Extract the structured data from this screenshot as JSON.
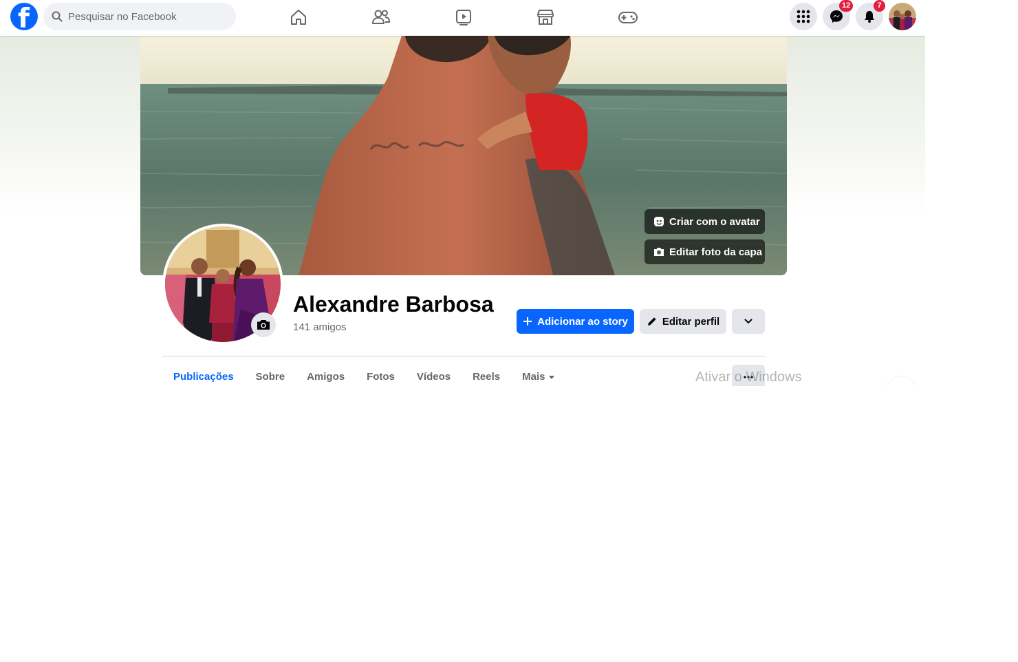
{
  "topbar": {
    "logo_letter": "f",
    "search_placeholder": "Pesquisar no Facebook",
    "nav": [
      "home-icon",
      "friends-icon",
      "watch-icon",
      "marketplace-icon",
      "gaming-icon"
    ],
    "messenger_badge": "12",
    "notifications_badge": "7"
  },
  "cover": {
    "avatar_button": "Criar com o avatar",
    "edit_cover_button": "Editar foto da capa"
  },
  "profile": {
    "name": "Alexandre Barbosa",
    "friends": "141 amigos"
  },
  "actions": {
    "add_story": "Adicionar ao story",
    "edit_profile": "Editar perfil"
  },
  "tabs": [
    {
      "label": "Publicações",
      "active": true
    },
    {
      "label": "Sobre",
      "active": false
    },
    {
      "label": "Amigos",
      "active": false
    },
    {
      "label": "Fotos",
      "active": false
    },
    {
      "label": "Vídeos",
      "active": false
    },
    {
      "label": "Reels",
      "active": false
    },
    {
      "label": "Mais",
      "active": false
    }
  ],
  "watermark": "Ativar o Windows",
  "colors": {
    "brand": "#0866ff",
    "badge": "#e41e3f"
  }
}
